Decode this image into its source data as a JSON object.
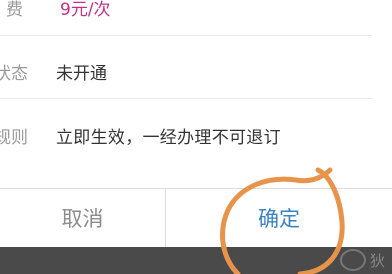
{
  "dialog": {
    "rows": [
      {
        "label": "费",
        "value": "9元/次"
      },
      {
        "label": "状态",
        "value": "未开通"
      },
      {
        "label": "规则",
        "value": "立即生效，一经办理不可退订"
      }
    ],
    "actions": {
      "cancel_label": "取消",
      "confirm_label": "确定"
    }
  },
  "navbar": {
    "text": "狄"
  },
  "colors": {
    "fee_value": "#c2308a",
    "confirm": "#3a83c4",
    "cancel": "#8c8c8c",
    "annotation": "#e8934a"
  }
}
